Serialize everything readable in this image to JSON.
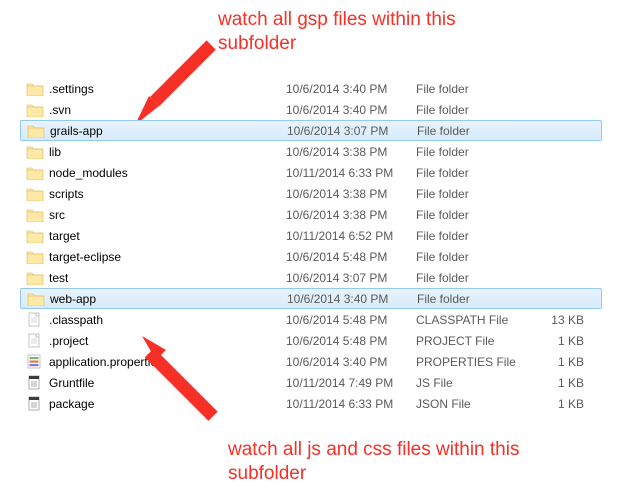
{
  "annotations": {
    "top": "watch all gsp files within this subfolder",
    "bottom": "watch all js and css files within this subfolder"
  },
  "colors": {
    "annotation": "#f63027",
    "selection": "#cde8ff"
  },
  "files": [
    {
      "name": ".settings",
      "date": "10/6/2014 3:40 PM",
      "type": "File folder",
      "size": "",
      "icon": "folder",
      "selected": false
    },
    {
      "name": ".svn",
      "date": "10/6/2014 3:40 PM",
      "type": "File folder",
      "size": "",
      "icon": "folder",
      "selected": false
    },
    {
      "name": "grails-app",
      "date": "10/6/2014 3:07 PM",
      "type": "File folder",
      "size": "",
      "icon": "folder",
      "selected": true
    },
    {
      "name": "lib",
      "date": "10/6/2014 3:38 PM",
      "type": "File folder",
      "size": "",
      "icon": "folder",
      "selected": false
    },
    {
      "name": "node_modules",
      "date": "10/11/2014 6:33 PM",
      "type": "File folder",
      "size": "",
      "icon": "folder",
      "selected": false
    },
    {
      "name": "scripts",
      "date": "10/6/2014 3:38 PM",
      "type": "File folder",
      "size": "",
      "icon": "folder",
      "selected": false
    },
    {
      "name": "src",
      "date": "10/6/2014 3:38 PM",
      "type": "File folder",
      "size": "",
      "icon": "folder",
      "selected": false
    },
    {
      "name": "target",
      "date": "10/11/2014 6:52 PM",
      "type": "File folder",
      "size": "",
      "icon": "folder",
      "selected": false
    },
    {
      "name": "target-eclipse",
      "date": "10/6/2014 5:48 PM",
      "type": "File folder",
      "size": "",
      "icon": "folder",
      "selected": false
    },
    {
      "name": "test",
      "date": "10/6/2014 3:07 PM",
      "type": "File folder",
      "size": "",
      "icon": "folder",
      "selected": false
    },
    {
      "name": "web-app",
      "date": "10/6/2014 3:40 PM",
      "type": "File folder",
      "size": "",
      "icon": "folder",
      "selected": true
    },
    {
      "name": ".classpath",
      "date": "10/6/2014 5:48 PM",
      "type": "CLASSPATH File",
      "size": "13 KB",
      "icon": "file",
      "selected": false
    },
    {
      "name": ".project",
      "date": "10/6/2014 5:48 PM",
      "type": "PROJECT File",
      "size": "1 KB",
      "icon": "file",
      "selected": false
    },
    {
      "name": "application.properties",
      "date": "10/6/2014 3:40 PM",
      "type": "PROPERTIES File",
      "size": "1 KB",
      "icon": "prop",
      "selected": false
    },
    {
      "name": "Gruntfile",
      "date": "10/11/2014 7:49 PM",
      "type": "JS File",
      "size": "1 KB",
      "icon": "js",
      "selected": false
    },
    {
      "name": "package",
      "date": "10/11/2014 6:33 PM",
      "type": "JSON File",
      "size": "1 KB",
      "icon": "js",
      "selected": false
    }
  ]
}
